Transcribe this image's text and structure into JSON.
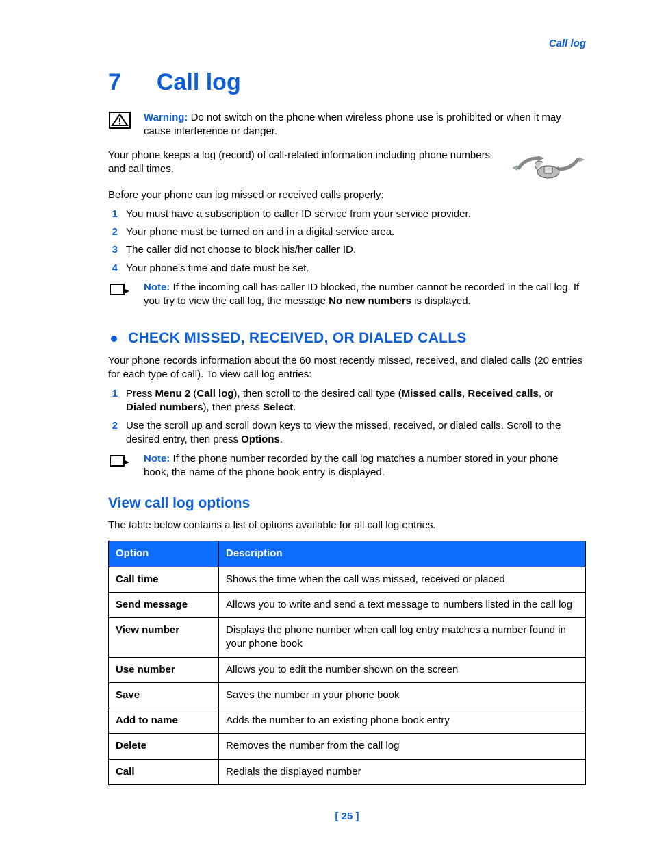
{
  "running_head": "Call log",
  "chapter": {
    "number": "7",
    "title": "Call log"
  },
  "warning": {
    "label": "Warning:",
    "text": " Do not switch on the phone when wireless phone use is prohibited or when it may cause interference or danger."
  },
  "intro_para": "Your phone keeps a log (record) of call-related information including phone numbers and call times.",
  "before_para": "Before your phone can log missed or received calls properly:",
  "prereq_list": [
    "You must have a subscription to caller ID service from your service provider.",
    "Your phone must be turned on and in a digital service area.",
    "The caller did not choose to block his/her caller ID.",
    "Your phone's time and date must be set."
  ],
  "note1": {
    "label": "Note:",
    "pre": " If the incoming call has caller ID blocked, the number cannot be recorded in the call log. If you try to view the call log, the message ",
    "bold": "No new numbers",
    "post": " is displayed."
  },
  "section2": {
    "title": "CHECK MISSED, RECEIVED, OR DIALED CALLS",
    "intro": "Your phone records information about the 60 most recently missed, received, and dialed calls (20 entries for each type of call). To view call log entries:",
    "steps": [
      {
        "parts": [
          {
            "t": "Press "
          },
          {
            "t": "Menu 2",
            "b": true
          },
          {
            "t": " ("
          },
          {
            "t": "Call log",
            "b": true
          },
          {
            "t": "), then scroll to the desired call type ("
          },
          {
            "t": "Missed calls",
            "b": true
          },
          {
            "t": ", "
          },
          {
            "t": "Received calls",
            "b": true
          },
          {
            "t": ", or "
          },
          {
            "t": "Dialed numbers",
            "b": true
          },
          {
            "t": "), then press "
          },
          {
            "t": "Select",
            "b": true
          },
          {
            "t": "."
          }
        ]
      },
      {
        "parts": [
          {
            "t": "Use the scroll up and scroll down keys to view the missed, received, or dialed calls. Scroll to the desired entry, then press "
          },
          {
            "t": "Options",
            "b": true
          },
          {
            "t": "."
          }
        ]
      }
    ]
  },
  "note2": {
    "label": "Note:",
    "text": " If the phone number recorded by the call log matches a number stored in your phone book, the name of the phone book entry is displayed."
  },
  "subhead": "View call log options",
  "table_intro": "The table below contains a list of options available for all call log entries.",
  "table": {
    "headers": [
      "Option",
      "Description"
    ],
    "rows": [
      [
        "Call time",
        "Shows the time when the call was missed, received or placed"
      ],
      [
        "Send message",
        "Allows you to write and send a text message to numbers listed in the call log"
      ],
      [
        "View number",
        "Displays the phone number when call log entry matches a number found in your phone book"
      ],
      [
        "Use number",
        "Allows you to edit the number shown on the screen"
      ],
      [
        "Save",
        "Saves the number in your phone book"
      ],
      [
        "Add to name",
        "Adds the number to an existing phone book entry"
      ],
      [
        "Delete",
        "Removes the number from the call log"
      ],
      [
        "Call",
        "Redials the displayed number"
      ]
    ]
  },
  "page_number": "[ 25 ]"
}
